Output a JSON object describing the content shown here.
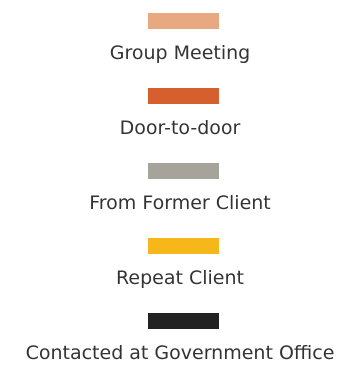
{
  "chart_data": {
    "type": "pie",
    "legend": "center",
    "series": [
      {
        "name": "Group Meeting",
        "color": "#E8A880"
      },
      {
        "name": "Door-to-door",
        "color": "#D65F2E"
      },
      {
        "name": "From Former Client",
        "color": "#A6A49A"
      },
      {
        "name": "Repeat Client",
        "color": "#F5B719"
      },
      {
        "name": "Contacted at Government Office",
        "color": "#222222"
      }
    ]
  }
}
